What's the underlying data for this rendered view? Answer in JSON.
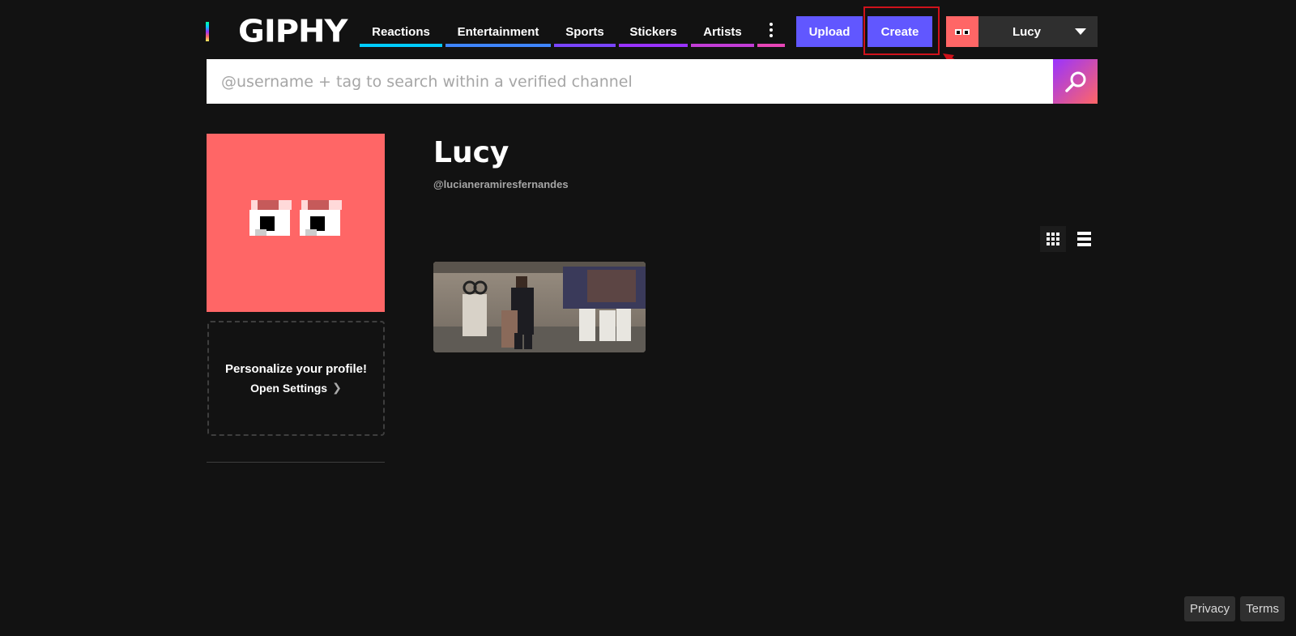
{
  "brand": {
    "logo_text": "GIPHY"
  },
  "nav": {
    "items": [
      {
        "label": "Reactions",
        "color": "#00ccff"
      },
      {
        "label": "Entertainment",
        "color": "#3f86ff"
      },
      {
        "label": "Sports",
        "color": "#7a45ff"
      },
      {
        "label": "Stickers",
        "color": "#9933ff"
      },
      {
        "label": "Artists",
        "color": "#c23dd6"
      }
    ],
    "more_icon": "vertical-dots-icon"
  },
  "actions": {
    "upload_label": "Upload",
    "create_label": "Create"
  },
  "user_menu": {
    "name": "Lucy"
  },
  "search": {
    "placeholder": "@username + tag to search within a verified channel"
  },
  "profile": {
    "display_name": "Lucy",
    "handle": "@lucianeramiresfernandes",
    "personalize_title": "Personalize your profile!",
    "open_settings_label": "Open Settings"
  },
  "view_toggle": {
    "grid_icon": "grid-view-icon",
    "list_icon": "list-view-icon",
    "active": "grid"
  },
  "footer": {
    "privacy_label": "Privacy",
    "terms_label": "Terms"
  },
  "colors": {
    "accent": "#6157ff",
    "avatar_bg": "#ff6666",
    "background": "#121212",
    "annotation": "#d0121b"
  }
}
